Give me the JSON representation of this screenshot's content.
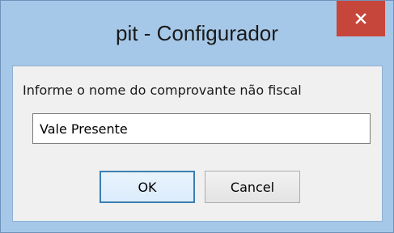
{
  "window": {
    "title": "pit - Configurador",
    "close_icon": "close-icon",
    "close_color": "#c7463b",
    "frame_color": "#a6c8e8"
  },
  "dialog": {
    "prompt": "Informe o nome do comprovante não fiscal",
    "input_value": "Vale Presente",
    "ok_label": "OK",
    "cancel_label": "Cancel"
  }
}
